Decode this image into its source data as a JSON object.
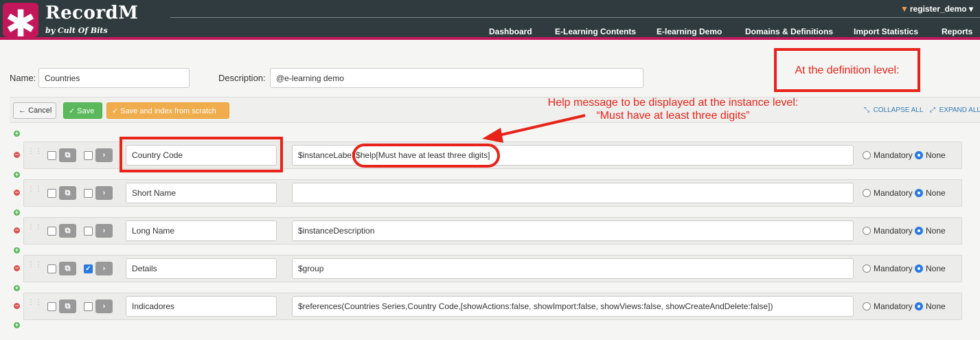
{
  "header": {
    "brand": "RecordM",
    "brand_sub": "by Cult Of Bits",
    "logo_glyph": "✱",
    "user": "register_demo",
    "user_caret": "▾",
    "nav": [
      "Dashboard",
      "E-Learning Contents",
      "E-learning Demo",
      "Domains & Definitions",
      "Import Statistics",
      "Reports"
    ]
  },
  "form": {
    "name_label": "Name:",
    "name_value": "Countries",
    "description_label": "Description:",
    "description_value": "@e-learning demo"
  },
  "toolbar": {
    "cancel_label": "Cancel",
    "cancel_icon": "←",
    "save_label": "Save",
    "save_icon": "✓",
    "index_label": "Save and index from scratch",
    "index_icon": "✓",
    "collapse_all": "COLLAPSE ALL",
    "expand_all": "EXPAND ALL"
  },
  "fields": [
    {
      "name": "Country Code",
      "description": "$instanceLabel $help[Must have at least three digits]",
      "checked": false,
      "mandatory": false
    },
    {
      "name": "Short Name",
      "description": "",
      "checked": false,
      "mandatory": false
    },
    {
      "name": "Long Name",
      "description": "$instanceDescription",
      "checked": false,
      "mandatory": false
    },
    {
      "name": "Details",
      "description": "$group",
      "checked": true,
      "mandatory": false
    },
    {
      "name": "Indicadores",
      "description": "$references(Countries Series,Country Code,[showActions:false, showImport:false, showViews:false, showCreateAndDelete:false])",
      "checked": false,
      "mandatory": false
    }
  ],
  "radio_labels": {
    "mandatory": "Mandatory",
    "none": "None"
  },
  "annotations": {
    "definition_level": "At the definition level:",
    "help_message": "Help message to be displayed at the instance level: “Must have at least three digits”"
  },
  "colors": {
    "accent": "#c2185b",
    "annotation": "#e8231a",
    "topbar": "#2f3b3f"
  }
}
